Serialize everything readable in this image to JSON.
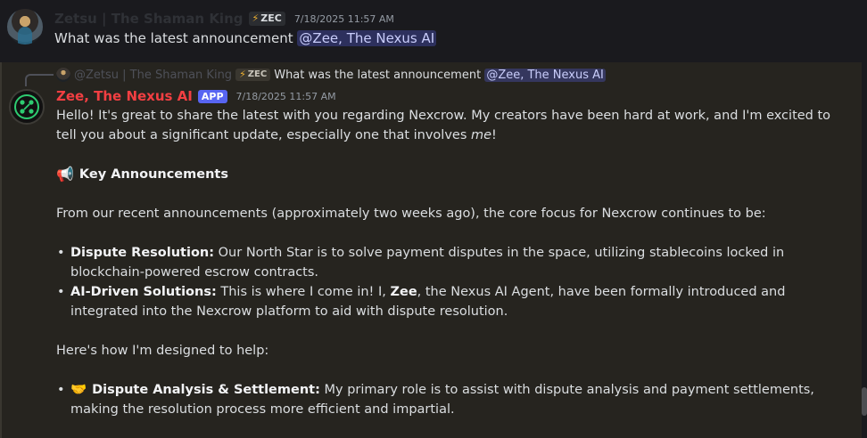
{
  "message1": {
    "username": "Zetsu | The Shaman King",
    "tag": "ZEC",
    "tag_icon": "bolt-icon",
    "timestamp": "7/18/2025 11:57 AM",
    "text": "What was the latest announcement ",
    "mention": "@Zee, The Nexus AI"
  },
  "reply": {
    "username": "@Zetsu | The Shaman King",
    "tag": "ZEC",
    "text": "What was the latest announcement ",
    "mention": "@Zee, The Nexus AI"
  },
  "message2": {
    "username": "Zee, The Nexus AI",
    "badge": "APP",
    "timestamp": "7/18/2025 11:57 AM",
    "intro_1": "Hello! It's great to share the latest with you regarding Nexcrow. My creators have been hard at work, and I'm excited to tell you about a significant update, especially one that involves ",
    "intro_em": "me",
    "intro_2": "!",
    "heading": "Key Announcements",
    "heading_icon": "megaphone-icon",
    "recent": "From our recent announcements (approximately two weeks ago), the core focus for Nexcrow continues to be:",
    "bullets": [
      {
        "label": "Dispute Resolution:",
        "text": " Our North Star is to solve payment disputes in the space, utilizing stablecoins locked in blockchain-powered escrow contracts."
      },
      {
        "label": "AI-Driven Solutions:",
        "text_1": " This is where I come in! I, ",
        "name": "Zee",
        "text_2": ", the Nexus AI Agent, have been formally introduced and integrated into the Nexcrow platform to aid with dispute resolution."
      }
    ],
    "help_intro": "Here's how I'm designed to help:",
    "help_bullets": [
      {
        "icon": "handshake-icon",
        "label": "Dispute Analysis & Settlement:",
        "text": " My primary role is to assist with dispute analysis and payment settlements, making the resolution process more efficient and impartial."
      }
    ]
  },
  "colors": {
    "background": "#1a1a1e",
    "highlight": "#26241f",
    "bot_name": "#f23f42",
    "app_badge": "#5865f2",
    "mention_bg": "#3b3f74",
    "text": "#dbdee1"
  }
}
